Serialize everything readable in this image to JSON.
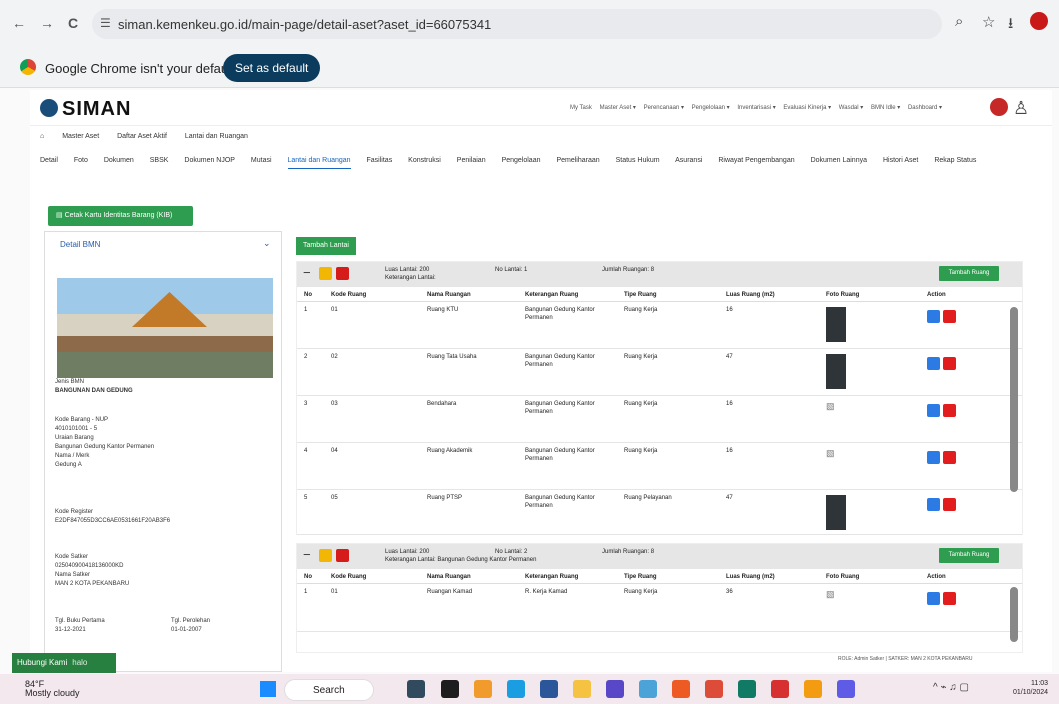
{
  "browser": {
    "back": "←",
    "forward": "→",
    "reload": "C",
    "url": "siman.kemenkeu.go.id/main-page/detail-aset?aset_id=66075341",
    "zoom_icon": "zoom-icon",
    "star_icon": "star-icon",
    "download_icon": "download-icon"
  },
  "infobar": {
    "message": "Google Chrome isn't your default browser",
    "button": "Set as default"
  },
  "app": {
    "logo": "SIMAN",
    "top_nav": [
      "My Task",
      "Master Aset ▾",
      "Perencanaan ▾",
      "Pengelolaan ▾",
      "Inventarisasi ▾",
      "Evaluasi Kinerja ▾",
      "Wasdal ▾",
      "BMN Idle ▾",
      "Dashboard ▾"
    ],
    "breadcrumb": [
      "Master Aset",
      "Daftar Aset Aktif",
      "Lantai dan Ruangan"
    ],
    "tabs": [
      "Detail",
      "Foto",
      "Dokumen",
      "SBSK",
      "Dokumen NJOP",
      "Mutasi",
      "Lantai dan Ruangan",
      "Fasilitas",
      "Konstruksi",
      "Penilaian",
      "Pengelolaan",
      "Pemeliharaan",
      "Status Hukum",
      "Asuransi",
      "Riwayat Pengembangan",
      "Dokumen Lainnya",
      "Histori Aset",
      "Rekap Status"
    ]
  },
  "kib_button": "Cetak Kartu Identitas Barang (KIB)",
  "detail": {
    "title": "Detail BMN",
    "jenis_label": "Jenis BMN",
    "jenis_value": "BANGUNAN DAN GEDUNG",
    "kode_block": "Kode Barang - NUP\n4010101001 - 5\nUraian Barang\nBangunan Gedung Kantor Permanen\nNama / Merk\nGedung A",
    "register_label": "Kode Register",
    "register_value": "E2DF847055D3CC6AE0531661F20AB3F6",
    "satker_block": "Kode Satker\n025040900418136000KD\nNama Satker\nMAN 2 KOTA PEKANBARU",
    "buku_label": "Tgl. Buku Pertama",
    "buku_value": "31-12-2021",
    "perolehan_label": "Tgl. Perolehan",
    "perolehan_value": "01-01-2007"
  },
  "right": {
    "add_floor": "Tambah Lantai",
    "floors": [
      {
        "luas": "Luas Lantai: 200",
        "keterangan": "Keterangan Lantai:",
        "no": "No Lantai: 1",
        "jumlah": "Jumlah Ruangan: 8",
        "add_room": "Tambah Ruang"
      },
      {
        "luas": "Luas Lantai: 200",
        "keterangan": "Keterangan Lantai: Bangunan Gedung Kantor Permanen",
        "no": "No Lantai: 2",
        "jumlah": "Jumlah Ruangan: 8",
        "add_room": "Tambah Ruang"
      }
    ],
    "headers": [
      "No",
      "Kode Ruang",
      "Nama Ruangan",
      "Keterangan Ruang",
      "Tipe Ruang",
      "Luas Ruang (m2)",
      "Foto Ruang",
      "Action"
    ],
    "rows": [
      {
        "no": "1",
        "kode": "01",
        "nama": "Ruang KTU",
        "ket": "Bangunan Gedung Kantor Permanen",
        "tipe": "Ruang Kerja",
        "luas": "16"
      },
      {
        "no": "2",
        "kode": "02",
        "nama": "Ruang Tata Usaha",
        "ket": "Bangunan Gedung Kantor Permanen",
        "tipe": "Ruang Kerja",
        "luas": "47"
      },
      {
        "no": "3",
        "kode": "03",
        "nama": "Bendahara",
        "ket": "Bangunan Gedung Kantor Permanen",
        "tipe": "Ruang Kerja",
        "luas": "16"
      },
      {
        "no": "4",
        "kode": "04",
        "nama": "Ruang Akademik",
        "ket": "Bangunan Gedung Kantor Permanen",
        "tipe": "Ruang Kerja",
        "luas": "16"
      },
      {
        "no": "5",
        "kode": "05",
        "nama": "Ruang PTSP",
        "ket": "Bangunan Gedung Kantor Permanen",
        "tipe": "Ruang Pelayanan",
        "luas": "47"
      }
    ],
    "floor2_row": {
      "no": "1",
      "kode": "01",
      "nama": "Ruangan Kamad",
      "ket": "R. Kerja Kamad",
      "tipe": "Ruang Kerja",
      "luas": "36"
    }
  },
  "chat": {
    "label": "Hubungi Kami",
    "badge": "halo"
  },
  "role": "ROLE: Admin Satker | SATKER: MAN 2 KOTA PEKANBARU",
  "taskbar": {
    "temp": "84°F",
    "weather": "Mostly cloudy",
    "search": "Search",
    "time": "11:03",
    "date": "01/10/2024"
  }
}
